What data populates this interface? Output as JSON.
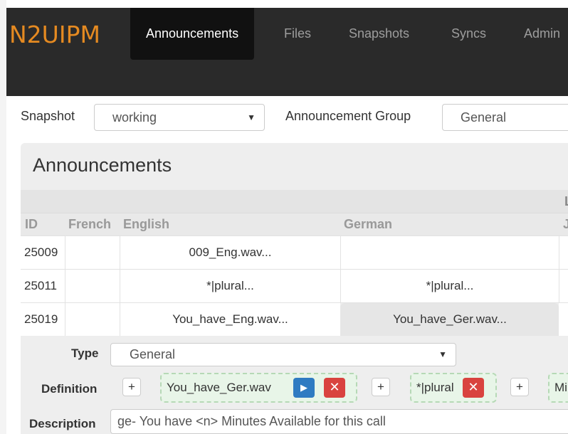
{
  "brand": "N2UIPM",
  "nav": {
    "items": [
      {
        "label": "Announcements",
        "active": true
      },
      {
        "label": "Files"
      },
      {
        "label": "Snapshots"
      },
      {
        "label": "Syncs"
      },
      {
        "label": "Admin"
      }
    ]
  },
  "filters": {
    "snapshot_label": "Snapshot",
    "snapshot_value": "working",
    "group_label": "Announcement Group",
    "group_value": "General"
  },
  "panel": {
    "title": "Announcements",
    "header_top_partial": "L",
    "columns": [
      "ID",
      "French",
      "English",
      "German",
      "J"
    ],
    "rows": [
      {
        "id": "25009",
        "french": "",
        "english": "009_Eng.wav...",
        "german": ""
      },
      {
        "id": "25011",
        "french": "",
        "english": "*|plural...",
        "german": "*|plural..."
      },
      {
        "id": "25019",
        "french": "",
        "english": "You_have_Eng.wav...",
        "german": "You_have_Ger.wav..."
      }
    ]
  },
  "detail": {
    "type_label": "Type",
    "type_value": "General",
    "definition_label": "Definition",
    "plus_glyph": "+",
    "chips": [
      {
        "text": "You_have_Ger.wav",
        "play_glyph": "▶",
        "delete_glyph": "✕"
      },
      {
        "text": "*|plural",
        "delete_glyph": "✕"
      },
      {
        "text": "Mi"
      }
    ],
    "description_label": "Description",
    "description_value": "ge- You have <n> Minutes Available for this call"
  },
  "colors": {
    "brand": "#e58a21",
    "navbar": "#2a2a2a",
    "play": "#2f7bc2",
    "delete": "#d9433f",
    "chip_bg": "#e8f5e8"
  }
}
